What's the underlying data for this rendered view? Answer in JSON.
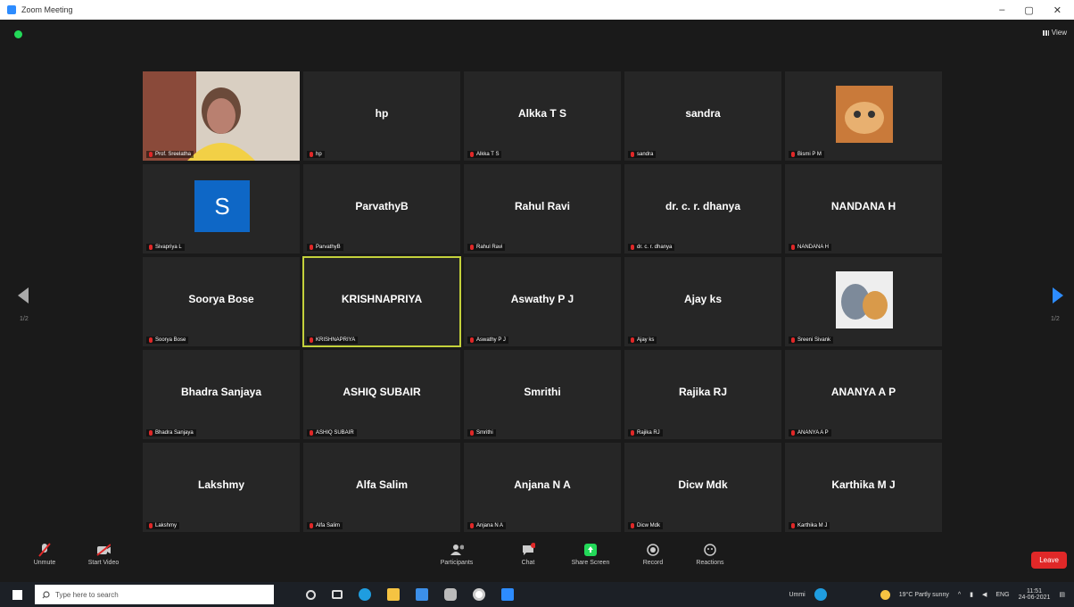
{
  "window": {
    "title": "Zoom Meeting",
    "controls": [
      "–",
      "▢",
      "✕"
    ]
  },
  "view_label": "View",
  "participants": [
    {
      "name": "",
      "label": "Prof. Sreelatha",
      "kind": "video"
    },
    {
      "name": "hp",
      "label": "hp"
    },
    {
      "name": "Alkka T S",
      "label": "Alkka T S"
    },
    {
      "name": "sandra",
      "label": "sandra"
    },
    {
      "name": "",
      "label": "Bismi P M",
      "kind": "pic"
    },
    {
      "name": "S",
      "label": "Sivapriya L",
      "kind": "avatar"
    },
    {
      "name": "ParvathyB",
      "label": "ParvathyB"
    },
    {
      "name": "Rahul Ravi",
      "label": "Rahul Ravi"
    },
    {
      "name": "dr. c. r. dhanya",
      "label": "dr. c. r. dhanya"
    },
    {
      "name": "NANDANA H",
      "label": "NANDANA H"
    },
    {
      "name": "Soorya Bose",
      "label": "Soorya Bose"
    },
    {
      "name": "KRISHNAPRIYA",
      "label": "KRISHNAPRIYA",
      "active": true
    },
    {
      "name": "Aswathy P J",
      "label": "Aswathy P J"
    },
    {
      "name": "Ajay ks",
      "label": "Ajay ks"
    },
    {
      "name": "",
      "label": "Sreeni Sivank",
      "kind": "pic2"
    },
    {
      "name": "Bhadra Sanjaya",
      "label": "Bhadra Sanjaya"
    },
    {
      "name": "ASHIQ SUBAIR",
      "label": "ASHIQ SUBAIR"
    },
    {
      "name": "Smrithi",
      "label": "Smrithi"
    },
    {
      "name": "Rajika RJ",
      "label": "Rajika RJ"
    },
    {
      "name": "ANANYA A P",
      "label": "ANANYA A P"
    },
    {
      "name": "Lakshmy",
      "label": "Lakshmy"
    },
    {
      "name": "Alfa Salim",
      "label": "Alfa Salim"
    },
    {
      "name": "Anjana N A",
      "label": "Anjana N A"
    },
    {
      "name": "Dicw Mdk",
      "label": "Dicw Mdk"
    },
    {
      "name": "Karthika M J",
      "label": "Karthika M J"
    }
  ],
  "pager": {
    "left": "1/2",
    "right": "1/2"
  },
  "toolbar": {
    "unmute": "Unmute",
    "start_video": "Start Video",
    "participants": "Participants",
    "chat": "Chat",
    "share_screen": "Share Screen",
    "record": "Record",
    "reactions": "Reactions",
    "leave": "Leave"
  },
  "taskbar": {
    "search_placeholder": "Type here to search",
    "weather": "19°C Partly sunny",
    "lang": "ENG",
    "time": "11:51",
    "date": "24-06-2021",
    "user": "Ummi"
  },
  "colors": {
    "active_outline": "#c4d13b",
    "leave": "#e02828",
    "accent": "#2d8cff"
  }
}
